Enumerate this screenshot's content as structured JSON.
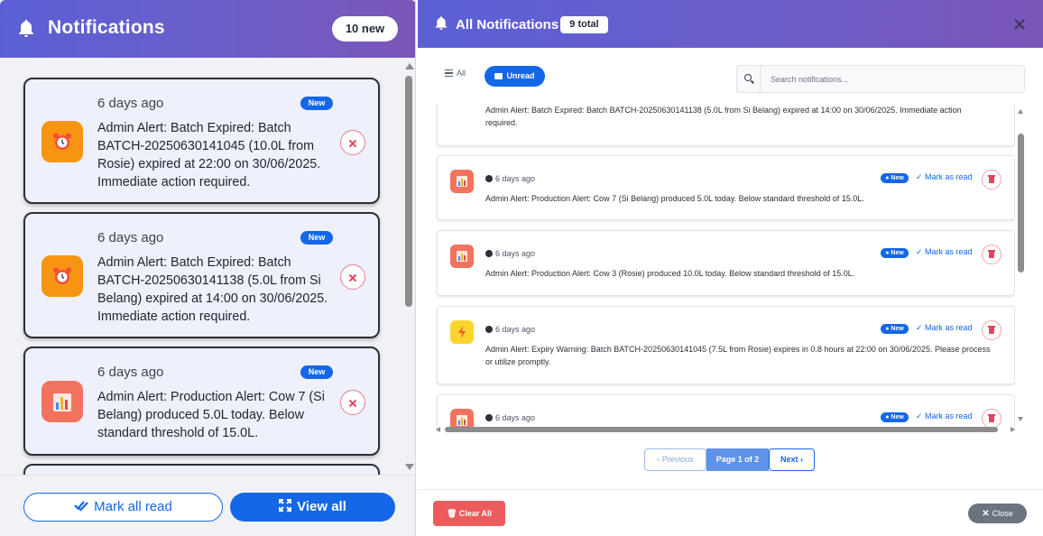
{
  "dropdown": {
    "title": "Notifications",
    "new_count": "10 new",
    "cards": [
      {
        "time": "6 days ago",
        "badge": "New",
        "message": "Admin Alert: Batch Expired: Batch BATCH-20250630141045 (10.0L from Rosie) expired at 22:00 on 30/06/2025. Immediate action required.",
        "icon": "alarm-clock-icon",
        "color": "#f79513"
      },
      {
        "time": "6 days ago",
        "badge": "New",
        "message": "Admin Alert: Batch Expired: Batch BATCH-20250630141138 (5.0L from Si Belang) expired at 14:00 on 30/06/2025. Immediate action required.",
        "icon": "alarm-clock-icon",
        "color": "#f79513"
      },
      {
        "time": "6 days ago",
        "badge": "New",
        "message": "Admin Alert: Production Alert: Cow 7 (Si Belang) produced 5.0L today. Below standard threshold of 15.0L.",
        "icon": "bar-chart-icon",
        "color": "#f2735d"
      }
    ],
    "mark_all_label": "Mark all read",
    "view_all_label": "View all"
  },
  "modal": {
    "title": "All Notifications",
    "total_count": "9 total",
    "tabs": {
      "all": "All",
      "unread": "Unread"
    },
    "search_placeholder": "Search notifications...",
    "partial_card_message": "Admin Alert: Batch Expired: Batch BATCH-20250630141138 (5.0L from Si Belang) expired at 14:00 on 30/06/2025. Immediate action required.",
    "cards": [
      {
        "time": "6 days ago",
        "badge": "New",
        "mark_label": "Mark as read",
        "message": "Admin Alert: Production Alert: Cow 7 (Si Belang) produced 5.0L today. Below standard threshold of 15.0L.",
        "icon": "bar-chart-icon",
        "color": "#f2735d"
      },
      {
        "time": "6 days ago",
        "badge": "New",
        "mark_label": "Mark as read",
        "message": "Admin Alert: Production Alert: Cow 3 (Rosie) produced 10.0L today. Below standard threshold of 15.0L.",
        "icon": "bar-chart-icon",
        "color": "#f2735d"
      },
      {
        "time": "6 days ago",
        "badge": "New",
        "mark_label": "Mark as read",
        "message": "Admin Alert: Expiry Warning: Batch BATCH-20250630141045 (7.5L from Rosie) expires in 0.8 hours at 22:00 on 30/06/2025. Please process or utilize promptly.",
        "icon": "lightning-icon",
        "color": "#fbd52d"
      },
      {
        "time": "6 days ago",
        "badge": "New",
        "mark_label": "Mark as read",
        "message": "",
        "icon": "bar-chart-icon",
        "color": "#f2735d"
      }
    ],
    "pagination": {
      "previous": "Previous",
      "current": "Page 1 of 2",
      "next": "Next"
    },
    "clear_all_label": "Clear All",
    "close_label": "Close"
  }
}
